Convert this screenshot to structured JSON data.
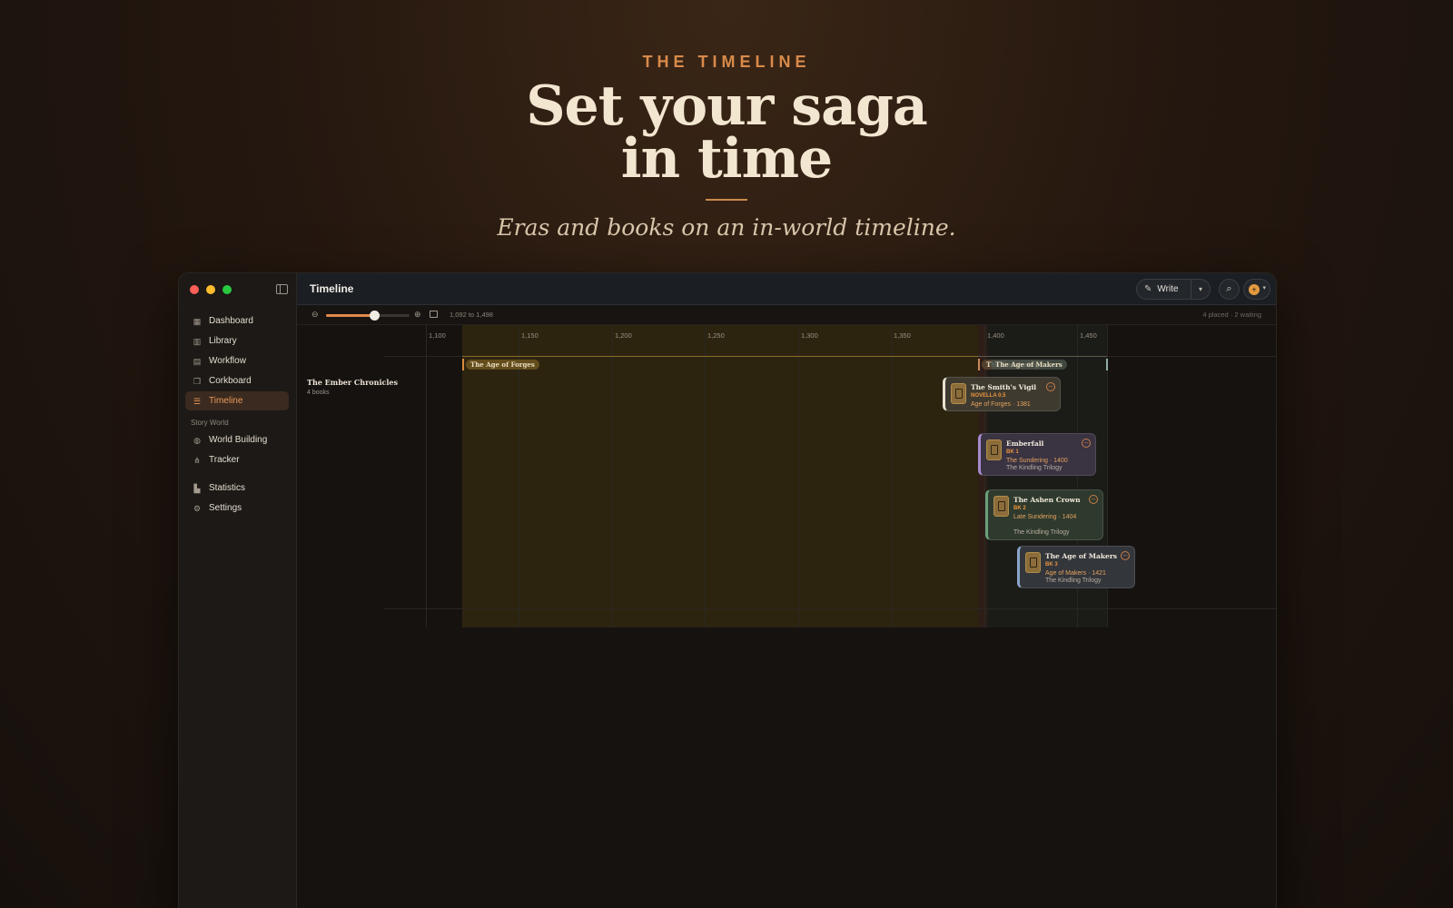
{
  "hero": {
    "eyebrow": "THE TIMELINE",
    "headline_line1": "Set your saga",
    "headline_line2": "in time",
    "tagline": "Eras and books on an in-world timeline."
  },
  "window": {
    "title": "Timeline",
    "write_label": "Write"
  },
  "sidebar": {
    "items": [
      {
        "label": "Dashboard",
        "icon": "grid-icon"
      },
      {
        "label": "Library",
        "icon": "books-icon"
      },
      {
        "label": "Workflow",
        "icon": "columns-icon"
      },
      {
        "label": "Corkboard",
        "icon": "cards-icon"
      },
      {
        "label": "Timeline",
        "icon": "timeline-icon",
        "active": true
      }
    ],
    "section_label": "Story World",
    "world_items": [
      {
        "label": "World Building",
        "icon": "globe-icon"
      },
      {
        "label": "Tracker",
        "icon": "network-icon"
      }
    ],
    "bottom_items": [
      {
        "label": "Statistics",
        "icon": "bar-chart-icon"
      },
      {
        "label": "Settings",
        "icon": "gear-icon"
      }
    ]
  },
  "toolbar": {
    "zoom_level": 0.58,
    "range_text": "1,092 to 1,498",
    "status_text": "4 placed · 2 waiting"
  },
  "timeline": {
    "ticks": [
      "1,100",
      "1,150",
      "1,200",
      "1,250",
      "1,300",
      "1,350",
      "1,400",
      "1,450"
    ],
    "track": {
      "name": "The Ember Chronicles",
      "subtitle": "4 books"
    },
    "eras": [
      {
        "label": "The Age of Forges",
        "color": "#d98a3a"
      },
      {
        "label": "The Sundering",
        "color": "#c98a5a"
      },
      {
        "label": "The Age of Makers",
        "color": "#8fb0a8"
      }
    ],
    "books": [
      {
        "title": "The Smith's Vigil",
        "badge": "NOVELLA 0.5",
        "meta": "Age of Forges · 1381",
        "series": "",
        "accent": "#e8e0d0"
      },
      {
        "title": "Emberfall",
        "badge": "BK 1",
        "meta": "The Sundering · 1400",
        "series": "The Kindling Trilogy",
        "accent": "#a98bd0"
      },
      {
        "title": "The Ashen Crown",
        "badge": "BK 2",
        "meta": "Late Sundering · 1404",
        "series": "The Kindling Trilogy",
        "accent": "#6aa07a"
      },
      {
        "title": "The Age of Makers",
        "badge": "BK 3",
        "meta": "Age of Makers · 1421",
        "series": "The Kindling Trilogy",
        "accent": "#8aa4c8"
      }
    ]
  }
}
